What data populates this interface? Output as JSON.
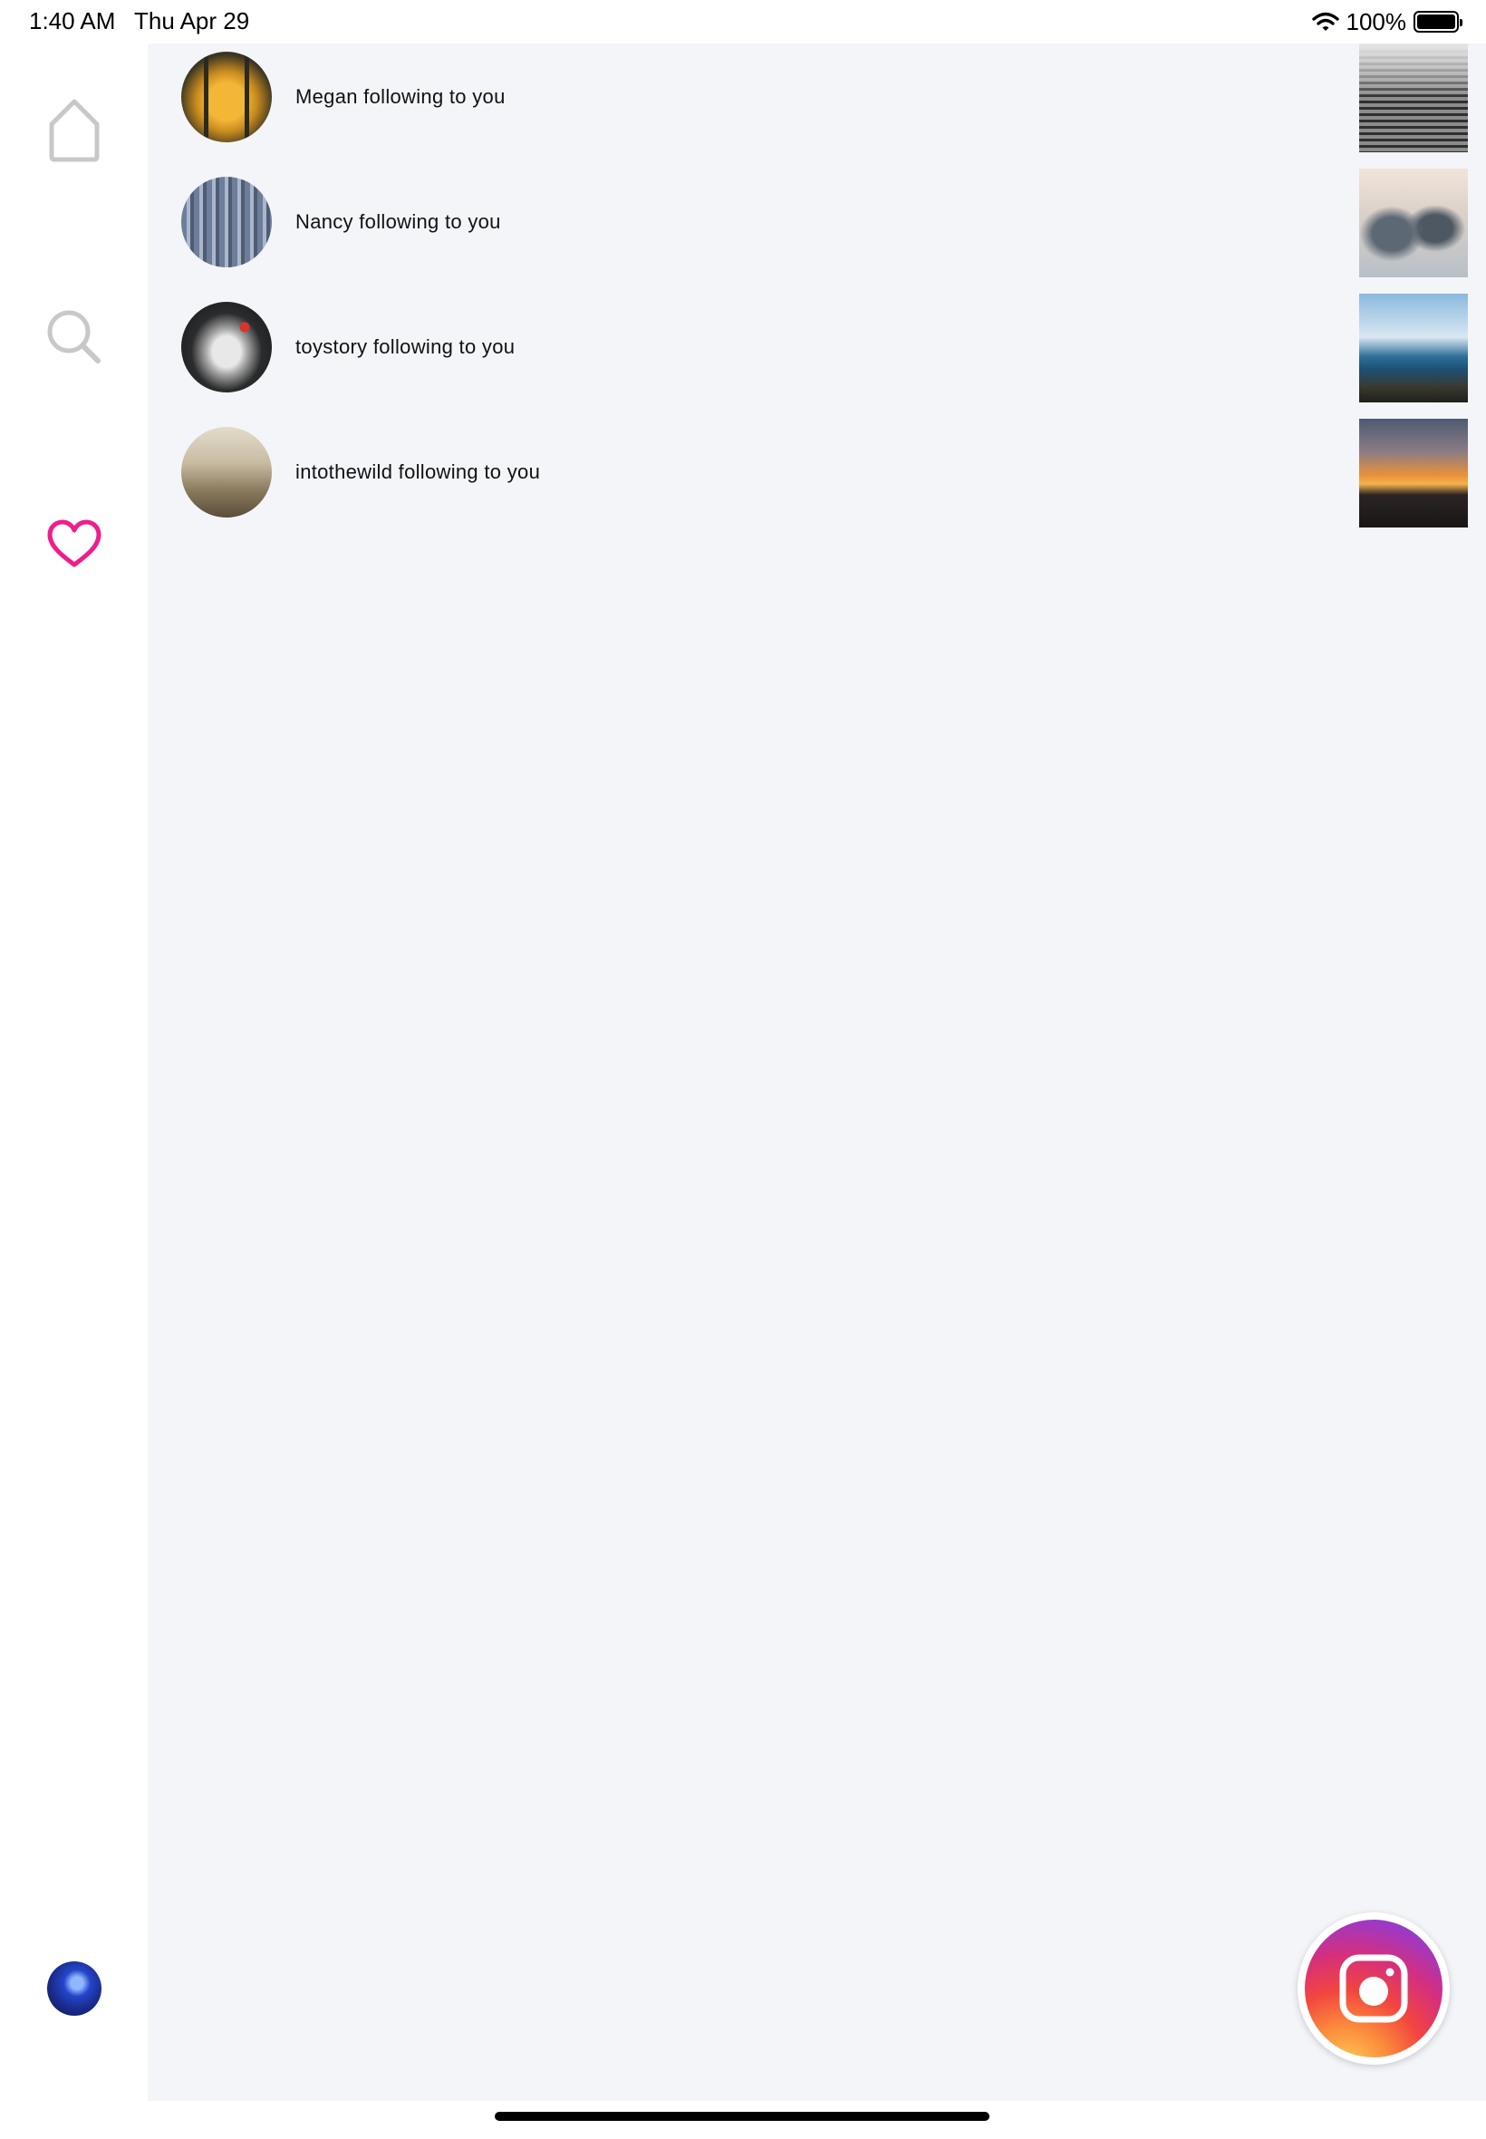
{
  "status_bar": {
    "time": "1:40 AM",
    "date": "Thu Apr 29",
    "battery_percent": "100%",
    "battery_level": 1.0
  },
  "sidebar": {
    "items": [
      {
        "name": "home",
        "icon": "home-icon",
        "active": false
      },
      {
        "name": "search",
        "icon": "search-icon",
        "active": false
      },
      {
        "name": "activity",
        "icon": "heart-icon",
        "active": true
      }
    ],
    "profile_icon": "avatar",
    "active_color": "#ee1e8c",
    "inactive_color": "#c8c8c8"
  },
  "notifications": [
    {
      "text": "Megan following to you",
      "avatar": "megan-avatar",
      "thumbnail": "misty-stairs-photo"
    },
    {
      "text": "Nancy following to you",
      "avatar": "nancy-avatar",
      "thumbnail": "snowy-trees-photo"
    },
    {
      "text": "toystory following to you",
      "avatar": "toystory-avatar",
      "thumbnail": "coastline-photo"
    },
    {
      "text": "intothewild following to you",
      "avatar": "intothewild-avatar",
      "thumbnail": "sunset-hills-photo"
    }
  ],
  "fab": {
    "icon": "camera-icon"
  },
  "colors": {
    "background": "#f4f5f9",
    "sidebar": "#ffffff"
  }
}
